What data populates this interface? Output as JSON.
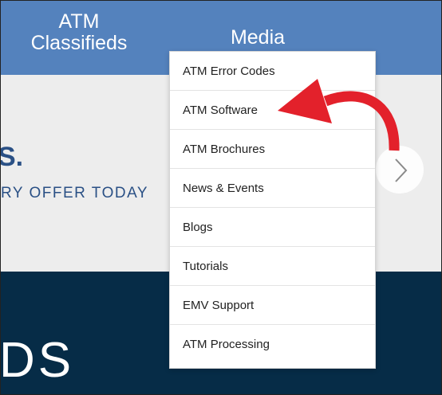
{
  "nav": {
    "classifieds_line1": "ATM",
    "classifieds_line2": "Classifieds",
    "media": "Media"
  },
  "hero": {
    "headline": "S.",
    "subline": "RY OFFER TODAY",
    "next_icon": "chevron-right-icon"
  },
  "dark_section": {
    "text": "DS"
  },
  "dropdown": {
    "items": [
      {
        "label": "ATM Error Codes"
      },
      {
        "label": "ATM Software"
      },
      {
        "label": "ATM Brochures"
      },
      {
        "label": "News & Events"
      },
      {
        "label": "Blogs"
      },
      {
        "label": "Tutorials"
      },
      {
        "label": "EMV Support"
      },
      {
        "label": "ATM Processing"
      }
    ]
  },
  "annotation": {
    "arrow_icon": "curved-arrow-icon",
    "color": "#e3212b"
  },
  "colors": {
    "navbar": "#5482bd",
    "hero_bg": "#ededed",
    "dark_bg": "#062c47",
    "hero_text": "#2a5085"
  }
}
